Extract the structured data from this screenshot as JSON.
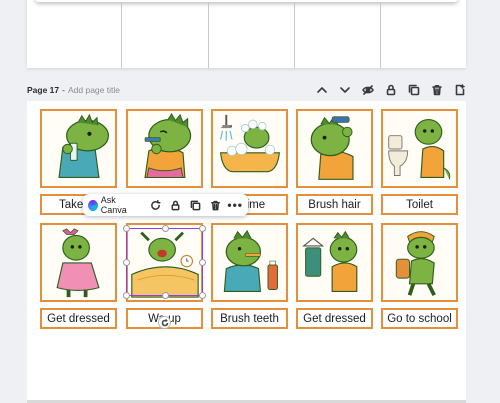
{
  "previous_page": {
    "columns": 4
  },
  "page_header": {
    "page_label": "Page 17",
    "separator": "-",
    "title_placeholder": "Add page title",
    "icons": [
      "chevron-up-icon",
      "chevron-down-icon",
      "eye-slash-icon",
      "lock-icon",
      "duplicate-icon",
      "trash-icon",
      "add-page-icon"
    ]
  },
  "cards": [
    {
      "label": "Take vit",
      "art": "dino-drinking"
    },
    {
      "label": "",
      "art": "dino-brushing-blue"
    },
    {
      "label": "h time",
      "art": "dino-bath"
    },
    {
      "label": "Brush hair",
      "art": "dino-brush-hair"
    },
    {
      "label": "Toilet",
      "art": "dino-toilet"
    },
    {
      "label": "Get dressed",
      "art": "dino-dress"
    },
    {
      "label": "Wa   up",
      "art": "dino-wake-up"
    },
    {
      "label": "Brush teeth",
      "art": "dino-brush-teeth"
    },
    {
      "label": "Get dressed",
      "art": "dino-dressed-hanger"
    },
    {
      "label": "Go to school",
      "art": "dino-school"
    }
  ],
  "floating_toolbar": {
    "ask_label": "Ask Canva",
    "icons": [
      "refresh-icon",
      "lock-icon",
      "duplicate-icon",
      "trash-icon"
    ],
    "more": "•••"
  },
  "colors": {
    "card_border": "#e58f3a",
    "selection": "#8b3dff",
    "dino_green": "#7cb342",
    "dino_dark": "#2e5e1e"
  }
}
